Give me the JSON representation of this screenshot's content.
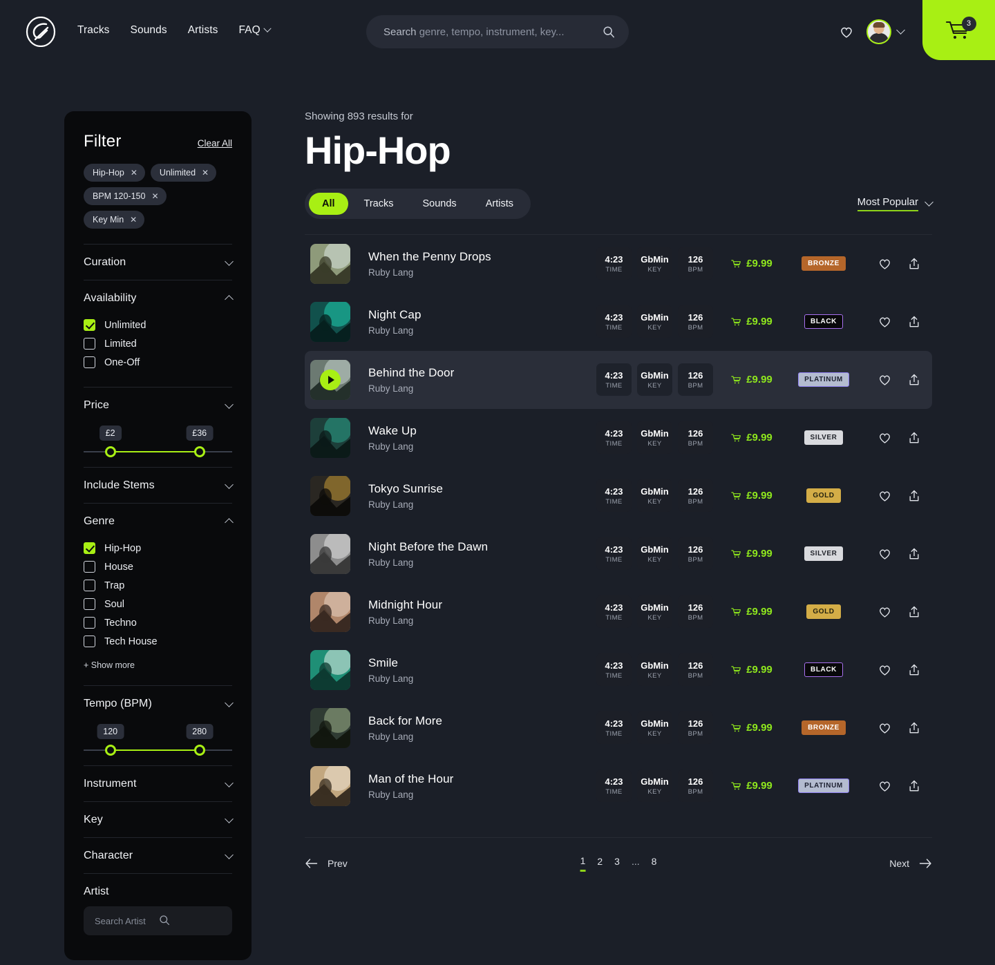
{
  "theme": {
    "accent": "#a8ef14",
    "page_bg": "#1b1f28",
    "panel_bg": "#090a0c"
  },
  "header": {
    "logo_name": "brand-logo",
    "nav": [
      {
        "label": "Tracks",
        "has_caret": false
      },
      {
        "label": "Sounds",
        "has_caret": false
      },
      {
        "label": "Artists",
        "has_caret": false
      },
      {
        "label": "FAQ",
        "has_caret": true
      }
    ],
    "search": {
      "lead": "Search",
      "placeholder": "genre, tempo, instrument, key...",
      "value": ""
    },
    "cart": {
      "count": "3"
    }
  },
  "sidebar": {
    "title": "Filter",
    "clear_all": "Clear All",
    "chips": [
      {
        "label": "Hip-Hop",
        "remove": "✕"
      },
      {
        "label": "Unlimited",
        "remove": "✕"
      },
      {
        "label": "BPM 120-150",
        "remove": "✕"
      },
      {
        "label": "Key Min",
        "remove": "✕"
      }
    ],
    "sections": {
      "curation": {
        "label": "Curation",
        "expanded": false
      },
      "availability": {
        "label": "Availability",
        "expanded": true,
        "options": [
          {
            "label": "Unlimited",
            "checked": true
          },
          {
            "label": "Limited",
            "checked": false
          },
          {
            "label": "One-Off",
            "checked": false
          }
        ]
      },
      "price": {
        "label": "Price",
        "expanded": false,
        "min_label": "£2",
        "max_label": "£36",
        "min_pct": 18,
        "max_pct": 78
      },
      "include_stems": {
        "label": "Include Stems",
        "expanded": false
      },
      "genre": {
        "label": "Genre",
        "expanded": true,
        "options": [
          {
            "label": "Hip-Hop",
            "checked": true
          },
          {
            "label": "House",
            "checked": false
          },
          {
            "label": "Trap",
            "checked": false
          },
          {
            "label": "Soul",
            "checked": false
          },
          {
            "label": "Techno",
            "checked": false
          },
          {
            "label": "Tech House",
            "checked": false
          }
        ],
        "show_more": "+ Show more"
      },
      "tempo": {
        "label": "Tempo (BPM)",
        "expanded": false,
        "min_label": "120",
        "max_label": "280",
        "min_pct": 18,
        "max_pct": 78
      },
      "instrument": {
        "label": "Instrument",
        "expanded": false
      },
      "key": {
        "label": "Key",
        "expanded": false
      },
      "character": {
        "label": "Character",
        "expanded": false
      },
      "artist": {
        "label": "Artist",
        "search_placeholder": "Search Artist",
        "search_value": ""
      }
    }
  },
  "main": {
    "showing": "Showing 893 results for",
    "title": "Hip-Hop",
    "tabs": [
      {
        "label": "All",
        "active": true
      },
      {
        "label": "Tracks",
        "active": false
      },
      {
        "label": "Sounds",
        "active": false
      },
      {
        "label": "Artists",
        "active": false
      }
    ],
    "sort": {
      "label": "Most Popular"
    },
    "meta_labels": {
      "time": "TIME",
      "key": "KEY",
      "bpm": "BPM"
    },
    "tracks": [
      {
        "title": "When the Penny Drops",
        "artist": "Ruby Lang",
        "time": "4:23",
        "key": "GbMin",
        "bpm": "126",
        "price": "£9.99",
        "tier": "BRONZE",
        "playing": false
      },
      {
        "title": "Night Cap",
        "artist": "Ruby Lang",
        "time": "4:23",
        "key": "GbMin",
        "bpm": "126",
        "price": "£9.99",
        "tier": "BLACK",
        "playing": false
      },
      {
        "title": "Behind the Door",
        "artist": "Ruby Lang",
        "time": "4:23",
        "key": "GbMin",
        "bpm": "126",
        "price": "£9.99",
        "tier": "PLATINUM",
        "playing": true
      },
      {
        "title": "Wake Up",
        "artist": "Ruby Lang",
        "time": "4:23",
        "key": "GbMin",
        "bpm": "126",
        "price": "£9.99",
        "tier": "SILVER",
        "playing": false
      },
      {
        "title": "Tokyo Sunrise",
        "artist": "Ruby Lang",
        "time": "4:23",
        "key": "GbMin",
        "bpm": "126",
        "price": "£9.99",
        "tier": "GOLD",
        "playing": false
      },
      {
        "title": "Night Before the Dawn",
        "artist": "Ruby Lang",
        "time": "4:23",
        "key": "GbMin",
        "bpm": "126",
        "price": "£9.99",
        "tier": "SILVER",
        "playing": false
      },
      {
        "title": "Midnight Hour",
        "artist": "Ruby Lang",
        "time": "4:23",
        "key": "GbMin",
        "bpm": "126",
        "price": "£9.99",
        "tier": "GOLD",
        "playing": false
      },
      {
        "title": "Smile",
        "artist": "Ruby Lang",
        "time": "4:23",
        "key": "GbMin",
        "bpm": "126",
        "price": "£9.99",
        "tier": "BLACK",
        "playing": false
      },
      {
        "title": "Back for More",
        "artist": "Ruby Lang",
        "time": "4:23",
        "key": "GbMin",
        "bpm": "126",
        "price": "£9.99",
        "tier": "BRONZE",
        "playing": false
      },
      {
        "title": "Man of the Hour",
        "artist": "Ruby Lang",
        "time": "4:23",
        "key": "GbMin",
        "bpm": "126",
        "price": "£9.99",
        "tier": "PLATINUM",
        "playing": false
      }
    ],
    "tier_styles": {
      "BRONZE": {
        "bg": "#b5662a",
        "fg": "#ffffff",
        "border": "#b5662a"
      },
      "BLACK": {
        "bg": "#08080a",
        "fg": "#ffffff",
        "border": "#a970f0"
      },
      "PLATINUM": {
        "bg": "#b4bcd0",
        "fg": "#1c2030",
        "border": "#8d7ff0"
      },
      "SILVER": {
        "bg": "#d9dade",
        "fg": "#22252c",
        "border": "#d9dade"
      },
      "GOLD": {
        "bg": "#d4ad47",
        "fg": "#24220f",
        "border": "#d4ad47"
      }
    },
    "pagination": {
      "prev": "Prev",
      "next": "Next",
      "pages": [
        {
          "label": "1",
          "active": true
        },
        {
          "label": "2",
          "active": false
        },
        {
          "label": "3",
          "active": false
        },
        {
          "label": "...",
          "active": false,
          "dots": true
        },
        {
          "label": "8",
          "active": false
        }
      ]
    }
  }
}
